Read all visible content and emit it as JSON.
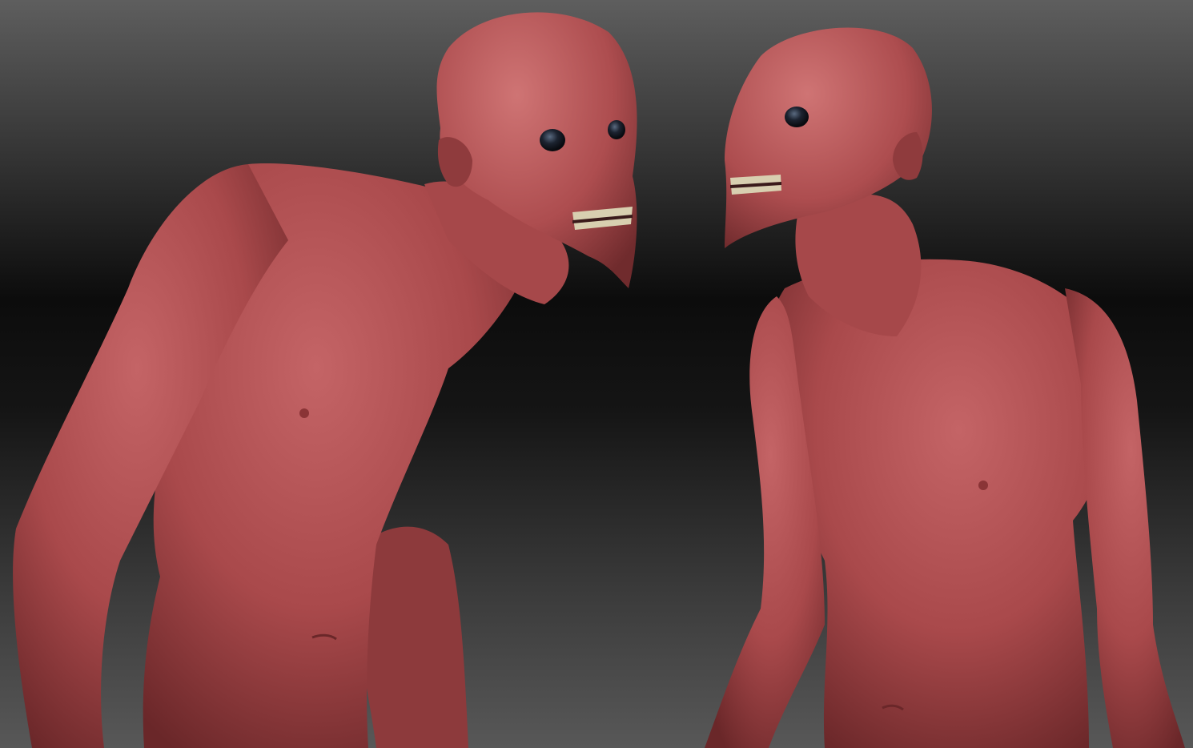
{
  "scene": {
    "background_top": "#5e5e5e",
    "background_mid": "#0c0c0c",
    "background_bottom": "#585858",
    "material_color": "#b04e4f",
    "material_shadow": "#6e2a2c",
    "material_highlight": "#cf7474",
    "teeth_color": "#d8cfb0",
    "eye_color": "#1c2330"
  }
}
